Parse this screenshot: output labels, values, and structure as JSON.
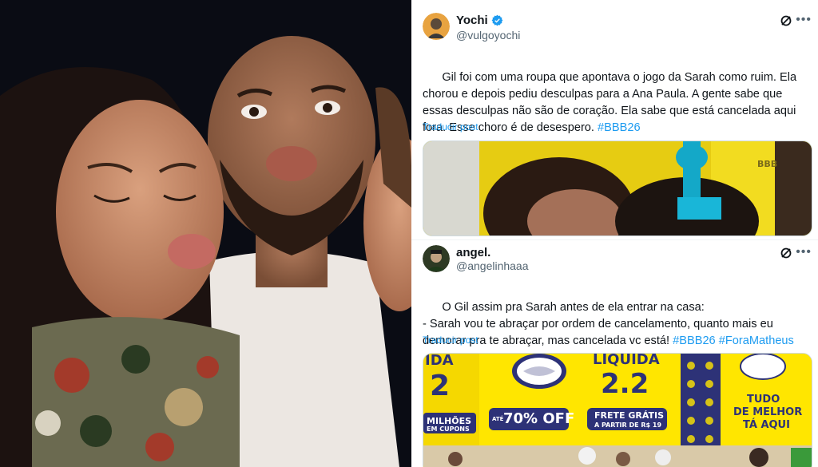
{
  "photo": {
    "description_icon": "people-photo"
  },
  "tweets": [
    {
      "display_name": "Yochi",
      "handle": "@vulgoyochi",
      "verified": true,
      "text_parts": [
        {
          "text": "Gil foi com uma roupa que apontava o jogo da Sarah como ruim. Ela chorou e depois pediu desculpas para a Ana Paula. A gente sabe que essas desculpas não são de coração. Ela sabe que está cancelada aqui fora. Esse choro é de desespero. ",
          "hashtag": false
        },
        {
          "text": "#BBB26",
          "hashtag": true
        }
      ],
      "translate_label": "Traducir post",
      "media_watermark": "BBB"
    },
    {
      "display_name": "angel.",
      "handle": "@angelinhaaa",
      "verified": false,
      "text_parts": [
        {
          "text": "O Gil assim pra Sarah antes de ela entrar na casa:\n- Sarah vou te abraçar por ordem de cancelamento, quanto mais eu demorar pra te abraçar, mas cancelada vc está! ",
          "hashtag": false
        },
        {
          "text": "#BBB26",
          "hashtag": true
        },
        {
          "text": " ",
          "hashtag": false
        },
        {
          "text": "#ForaMatheus",
          "hashtag": true
        }
      ],
      "translate_label": "Traducir post",
      "media_signs": {
        "left_top": "IDA",
        "left_num": "2",
        "left_sub": "MILHÕES",
        "left_sub2": "EM CUPONS",
        "center_top": "LIQUIDA",
        "center_num": "2.2",
        "off": "70% OFF",
        "off_prefix": "ATÉ",
        "frete": "FRETE GRÁTIS",
        "frete_sub": "A PARTIR DE R$ 19",
        "right_1": "TUDO",
        "right_2": "DE MELHOR",
        "right_3": "TÁ AQUI"
      }
    }
  ],
  "colors": {
    "accent": "#1d9bf0",
    "ml_yellow": "#ffe600",
    "ml_blue": "#2d3277"
  }
}
